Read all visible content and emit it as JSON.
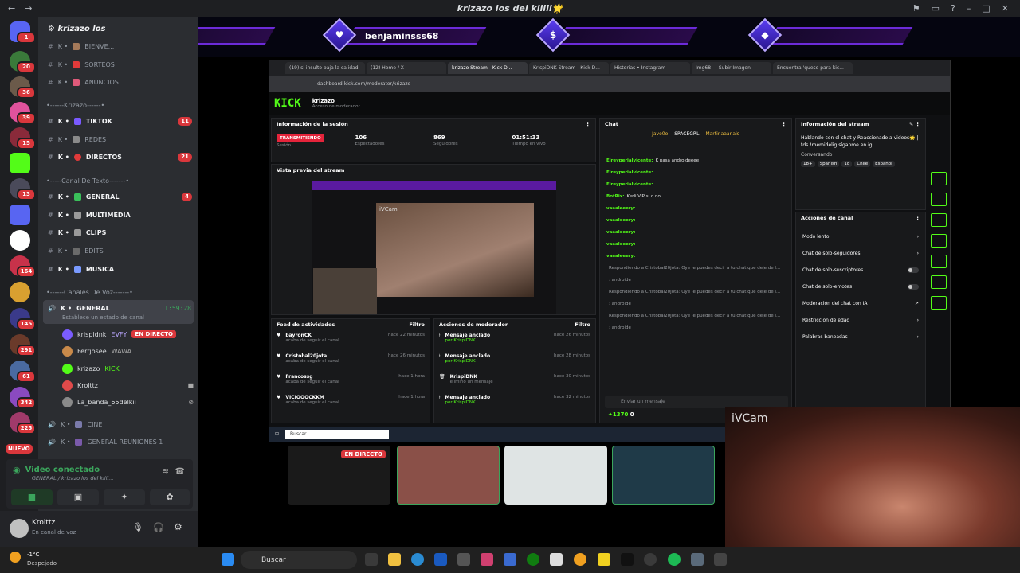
{
  "window": {
    "title": "krizazo los del kiiiii🌟"
  },
  "server_badges": [
    "1",
    "20",
    "36",
    "39",
    "15",
    "13",
    "164",
    "145",
    "291",
    "61",
    "342",
    "225"
  ],
  "server_new": "NUEVO",
  "channel_panel": {
    "server_name": "krizazo los",
    "channels_top": [
      {
        "prefix": "K •",
        "name": "BIENVE..."
      },
      {
        "prefix": "K •",
        "name": "SORTEOS"
      },
      {
        "prefix": "K •",
        "name": "ANUNCIOS"
      }
    ],
    "cat_krizazo": "•------Krizazo------•",
    "channels_mid": [
      {
        "prefix": "K •",
        "name": "TIKTOK",
        "count": "11"
      },
      {
        "prefix": "K •",
        "name": "REDES",
        "count": ""
      },
      {
        "prefix": "K •",
        "name": "DIRECTOS",
        "count": "21"
      }
    ],
    "cat_text": "•-----Canal De Texto-------•",
    "channels_text": [
      {
        "prefix": "K •",
        "name": "GENERAL",
        "count": "4"
      },
      {
        "prefix": "K •",
        "name": "MULTIMEDIA",
        "count": ""
      },
      {
        "prefix": "K •",
        "name": "CLIPS",
        "count": ""
      },
      {
        "prefix": "K •",
        "name": "EDITS",
        "count": ""
      },
      {
        "prefix": "K •",
        "name": "MUSICA",
        "count": ""
      }
    ],
    "cat_voice": "•------Canales De Voz-------•",
    "voice_general": {
      "prefix": "K •",
      "name": "GENERAL",
      "time": "1:59:28",
      "status": "Establece un estado de canal"
    },
    "voice_users": [
      {
        "name": "krispidnk",
        "tag": "EVFY",
        "live": "EN DIRECTO",
        "color": "#7a5cff"
      },
      {
        "name": "Ferrjosee",
        "tag": "WAWA",
        "live": "",
        "color": "#c98a4a"
      },
      {
        "name": "krizazo",
        "tag": "KICK",
        "live": "",
        "color": "#53fc18"
      },
      {
        "name": "Krolttz",
        "tag": "",
        "live": "",
        "color": "#e04a4a"
      },
      {
        "name": "La_banda_65delkii",
        "tag": "",
        "live": "",
        "color": "#8a8a8a"
      }
    ],
    "voice_more": [
      {
        "prefix": "K •",
        "name": "CINE"
      },
      {
        "prefix": "K •",
        "name": "GENERAL REUNIONES 1"
      }
    ],
    "video_panel": {
      "title": "Video conectado",
      "path": "GENERAL / krizazo los del kiiii..."
    },
    "user": {
      "name": "Krolttz",
      "status": "En canal de voz"
    }
  },
  "banner": {
    "name": "benjaminsss68",
    "icons": [
      "★",
      "♥",
      "$",
      "◆"
    ]
  },
  "browser": {
    "tabs": [
      "(19) si insulto baja la calidad",
      "(12) Home / X",
      "krizazo Stream - Kick D...",
      "KrispiDNK Stream - Kick D...",
      "Historias • Instagram",
      "Img68 — Subir Imagen —",
      "Encuentra 'queso para kic..."
    ],
    "url": "dashboard.kick.com/moderator/krizazo",
    "kick": {
      "logo": "KICK",
      "channel": "krizazo",
      "role": "Acceso de moderador"
    },
    "session": {
      "title": "Información de la sesión",
      "state": "TRANSMITIENDO",
      "state_label": "Sesión",
      "viewers": "106",
      "viewers_label": "Espectadores",
      "followers": "869",
      "followers_label": "Seguidores",
      "live_time": "01:51:33",
      "live_time_label": "Tiempo en vivo"
    },
    "preview": {
      "title": "Vista previa del stream",
      "cam": "iVCam"
    },
    "feed": {
      "title": "Feed de actividades",
      "filter": "Filtro",
      "items": [
        {
          "user": "bayronCK",
          "action": "acaba de seguir el canal",
          "time": "hace 22 minutos"
        },
        {
          "user": "Cristobal20jota",
          "action": "acaba de seguir el canal",
          "time": "hace 26 minutos"
        },
        {
          "user": "Francossg",
          "action": "acaba de seguir el canal",
          "time": "hace 1 hora"
        },
        {
          "user": "VICIOOOCKKM",
          "action": "acaba de seguir el canal",
          "time": "hace 1 hora"
        }
      ]
    },
    "mod": {
      "title": "Acciones de moderador",
      "filter": "Filtro",
      "items": [
        {
          "action": "Mensaje anclado",
          "by": "por KrispiDNK",
          "time": "hace 26 minutos"
        },
        {
          "action": "Mensaje anclado",
          "by": "por KrispiDNK",
          "time": "hace 28 minutos"
        },
        {
          "action": "KrispiDNK",
          "by": "eliminó un mensaje",
          "time": "hace 30 minutos"
        },
        {
          "action": "Mensaje anclado",
          "by": "por KrispiDNK",
          "time": "hace 32 minutos"
        }
      ]
    },
    "chat": {
      "title": "Chat",
      "top_users": [
        "Javo0o",
        "SPACEGRL",
        "Martinaaanais"
      ],
      "lines": [
        {
          "user": "Eireyperialvicente:",
          "text": "K pasa androideeee"
        },
        {
          "user": "Eireyperialvicente:",
          "text": ""
        },
        {
          "user": "Eireyperialvicente:",
          "text": ""
        },
        {
          "user": "BotRix:",
          "text": "Kerli VIP si o no"
        },
        {
          "user": "vaaaleeery:",
          "text": ""
        },
        {
          "user": "vaaaleeery:",
          "text": ""
        },
        {
          "user": "vaaaleeery:",
          "text": ""
        },
        {
          "user": "vaaaleeery:",
          "text": ""
        },
        {
          "user": "vaaaleeery:",
          "text": ""
        },
        {
          "user": "",
          "text": "Respondiendo a Cristobal20jota: Oye le puedes decir a tu chat que deje de l..."
        },
        {
          "user": "",
          "text": ": androide"
        },
        {
          "user": "",
          "text": "Respondiendo a Cristobal20jota: Oye le puedes decir a tu chat que deje de l..."
        },
        {
          "user": "",
          "text": ": androide"
        },
        {
          "user": "",
          "text": "Respondiendo a Cristobal20jota: Oye le puedes decir a tu chat que deje de l..."
        },
        {
          "user": "",
          "text": ": androide"
        }
      ],
      "placeholder": "Enviar un mensaje",
      "points": "1370",
      "count": "0"
    },
    "stream_info": {
      "title": "Información del stream",
      "desc": "Hablando con el chat y Reaccionado a videos🌟 | tds !memidelig síganme en ig...",
      "category": "Conversando",
      "tags": [
        "18+",
        "Spanish",
        "18",
        "Chile",
        "Español"
      ]
    },
    "channel_actions": {
      "title": "Acciones de canal",
      "items": [
        "Modo lento",
        "Chat de solo-seguidores",
        "Chat de solo-suscriptores",
        "Chat de solo-emotes",
        "Moderación del chat con IA",
        "Restricción de edad",
        "Palabras baneadas"
      ]
    },
    "inner_search": "Buscar"
  },
  "stream_thumbs": {
    "live": "EN DIRECTO"
  },
  "ivcam_label": "iVCam",
  "taskbar": {
    "weather_temp": "-1°C",
    "weather_desc": "Despejado",
    "search": "Buscar"
  }
}
